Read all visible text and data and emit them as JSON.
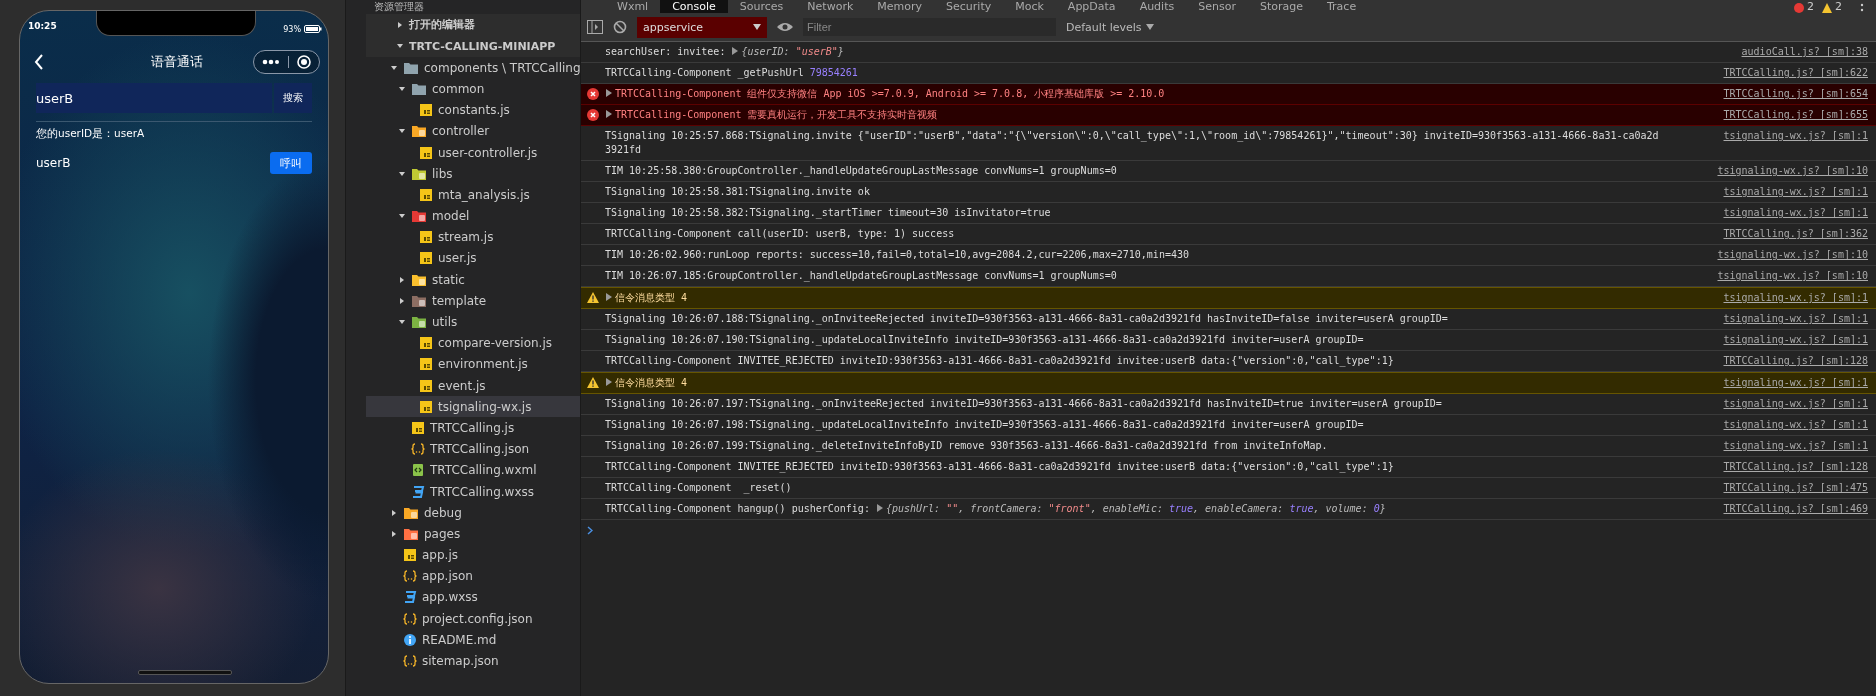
{
  "phone": {
    "status": {
      "time": "10:25",
      "battery": "93%"
    },
    "title": "语音通话",
    "search": {
      "value": "userB",
      "button": "搜索"
    },
    "own_id": "您的userID是：userA",
    "result": {
      "name": "userB",
      "button": "呼叫"
    }
  },
  "explorer": {
    "title": "资源管理器",
    "sections": [
      {
        "label": "打开的编辑器",
        "expanded": false
      },
      {
        "label": "TRTC-CALLING-MINIAPP",
        "expanded": true,
        "items": [
          {
            "kind": "folder",
            "label": "components \\ TRTCCalling",
            "expanded": true,
            "selected": false,
            "children": [
              {
                "kind": "folder",
                "label": "common",
                "expanded": true,
                "selected": false,
                "children": [
                  {
                    "kind": "script",
                    "label": "constants.js",
                    "selected": false
                  }
                ]
              },
              {
                "kind": "controller",
                "label": "controller",
                "expanded": true,
                "selected": false,
                "children": [
                  {
                    "kind": "script",
                    "label": "user-controller.js",
                    "selected": false
                  }
                ]
              },
              {
                "kind": "libs",
                "label": "libs",
                "expanded": true,
                "selected": false,
                "children": [
                  {
                    "kind": "script",
                    "label": "mta_analysis.js",
                    "selected": false
                  }
                ]
              },
              {
                "kind": "model",
                "label": "model",
                "expanded": true,
                "selected": false,
                "children": [
                  {
                    "kind": "script",
                    "label": "stream.js",
                    "selected": false
                  },
                  {
                    "kind": "script",
                    "label": "user.js",
                    "selected": false
                  }
                ]
              },
              {
                "kind": "static",
                "label": "static",
                "expanded": false,
                "selected": false
              },
              {
                "kind": "template",
                "label": "template",
                "expanded": false,
                "selected": false
              },
              {
                "kind": "utils",
                "label": "utils",
                "expanded": true,
                "selected": false,
                "children": [
                  {
                    "kind": "script",
                    "label": "compare-version.js",
                    "selected": false
                  },
                  {
                    "kind": "script",
                    "label": "environment.js",
                    "selected": false
                  },
                  {
                    "kind": "script",
                    "label": "event.js",
                    "selected": false
                  },
                  {
                    "kind": "script",
                    "label": "tsignaling-wx.js",
                    "selected": true
                  }
                ]
              },
              {
                "kind": "script",
                "label": "TRTCCalling.js",
                "selected": false
              },
              {
                "kind": "data",
                "label": "TRTCCalling.json",
                "selected": false
              },
              {
                "kind": "markup",
                "label": "TRTCCalling.wxml",
                "selected": false
              },
              {
                "kind": "style",
                "label": "TRTCCalling.wxss",
                "selected": false
              }
            ]
          },
          {
            "kind": "debug",
            "label": "debug",
            "expanded": false,
            "selected": false
          },
          {
            "kind": "pages",
            "label": "pages",
            "expanded": false,
            "selected": false
          },
          {
            "kind": "script",
            "label": "app.js",
            "selected": false
          },
          {
            "kind": "data",
            "label": "app.json",
            "selected": false
          },
          {
            "kind": "style",
            "label": "app.wxss",
            "selected": false
          },
          {
            "kind": "data",
            "label": "project.config.json",
            "selected": false
          },
          {
            "kind": "readme",
            "label": "README.md",
            "selected": false
          },
          {
            "kind": "data",
            "label": "sitemap.json",
            "selected": false
          }
        ]
      }
    ]
  },
  "devtools": {
    "tabs": [
      {
        "label": "Wxml",
        "selected": false
      },
      {
        "label": "Console",
        "selected": true
      },
      {
        "label": "Sources",
        "selected": false
      },
      {
        "label": "Network",
        "selected": false
      },
      {
        "label": "Memory",
        "selected": false
      },
      {
        "label": "Security",
        "selected": false
      },
      {
        "label": "Mock",
        "selected": false
      },
      {
        "label": "AppData",
        "selected": false
      },
      {
        "label": "Audits",
        "selected": false
      },
      {
        "label": "Sensor",
        "selected": false
      },
      {
        "label": "Storage",
        "selected": false
      },
      {
        "label": "Trace",
        "selected": false
      }
    ],
    "error_count": "2",
    "warning_count": "2",
    "context": "appservice",
    "filter_placeholder": "Filter",
    "levels": "Default levels",
    "rows": [
      {
        "kind": "log",
        "segments": [
          {
            "expandable": false,
            "parts": [
              {
                "text": "searchUser: invitee: ",
                "kind": "text"
              }
            ]
          },
          {
            "expandable": true,
            "parts": [
              {
                "text": "{userID: ",
                "kind": "key"
              },
              {
                "text": "\"userB\"",
                "kind": "string"
              },
              {
                "text": "}",
                "kind": "key"
              }
            ]
          }
        ],
        "source": "audioCall.js? [sm]:38"
      },
      {
        "kind": "log",
        "segments": [
          {
            "expandable": false,
            "parts": [
              {
                "text": "TRTCCalling-Component _getPushUrl ",
                "kind": "text"
              },
              {
                "text": "79854261",
                "kind": "number"
              }
            ]
          }
        ],
        "source": "TRTCCalling.js? [sm]:622"
      },
      {
        "kind": "error",
        "segments": [
          {
            "expandable": true,
            "parts": [
              {
                "text": "TRTCCalling-Component 组件仅支持微信 App iOS >=7.0.9, Android >= 7.0.8, 小程序基础库版 >= 2.10.0",
                "kind": "text"
              }
            ]
          }
        ],
        "source": "TRTCCalling.js? [sm]:654"
      },
      {
        "kind": "error",
        "segments": [
          {
            "expandable": true,
            "parts": [
              {
                "text": "TRTCCalling-Component 需要真机运行，开发工具不支持实时音视频",
                "kind": "text"
              }
            ]
          }
        ],
        "source": "TRTCCalling.js? [sm]:655"
      },
      {
        "kind": "log",
        "segments": [
          {
            "expandable": false,
            "parts": [
              {
                "text": "TSignaling 10:25:57.868:TSignaling.invite {\"userID\":\"userB\",\"data\":\"{\\\"version\\\":0,\\\"call_type\\\":1,\\\"room_id\\\":79854261}\",\"timeout\":30} inviteID=930f3563-a131-4666-8a31-ca0a2d3921fd",
                "kind": "text"
              }
            ]
          }
        ],
        "source": "tsignaling-wx.js? [sm]:1"
      },
      {
        "kind": "log",
        "segments": [
          {
            "expandable": false,
            "parts": [
              {
                "text": "TIM 10:25:58.380:GroupController._handleUpdateGroupLastMessage convNums=1 groupNums=0",
                "kind": "text"
              }
            ]
          }
        ],
        "source": "tsignaling-wx.js? [sm]:10"
      },
      {
        "kind": "log",
        "segments": [
          {
            "expandable": false,
            "parts": [
              {
                "text": "TSignaling 10:25:58.381:TSignaling.invite ok",
                "kind": "text"
              }
            ]
          }
        ],
        "source": "tsignaling-wx.js? [sm]:1"
      },
      {
        "kind": "log",
        "segments": [
          {
            "expandable": false,
            "parts": [
              {
                "text": "TSignaling 10:25:58.382:TSignaling._startTimer timeout=30 isInvitator=true",
                "kind": "text"
              }
            ]
          }
        ],
        "source": "tsignaling-wx.js? [sm]:1"
      },
      {
        "kind": "log",
        "segments": [
          {
            "expandable": false,
            "parts": [
              {
                "text": "TRTCCalling-Component call(userID: userB, type: 1) success",
                "kind": "text"
              }
            ]
          }
        ],
        "source": "TRTCCalling.js? [sm]:362"
      },
      {
        "kind": "log",
        "segments": [
          {
            "expandable": false,
            "parts": [
              {
                "text": "TIM 10:26:02.960:runLoop reports: success=10,fail=0,total=10,avg=2084.2,cur=2206,max=2710,min=430",
                "kind": "text"
              }
            ]
          }
        ],
        "source": "tsignaling-wx.js? [sm]:10"
      },
      {
        "kind": "log",
        "segments": [
          {
            "expandable": false,
            "parts": [
              {
                "text": "TIM 10:26:07.185:GroupController._handleUpdateGroupLastMessage convNums=1 groupNums=0",
                "kind": "text"
              }
            ]
          }
        ],
        "source": "tsignaling-wx.js? [sm]:10"
      },
      {
        "kind": "warning",
        "segments": [
          {
            "expandable": true,
            "parts": [
              {
                "text": "信令消息类型 ",
                "kind": "text"
              },
              {
                "text": "4",
                "kind": "number"
              }
            ]
          }
        ],
        "source": "tsignaling-wx.js? [sm]:1"
      },
      {
        "kind": "log",
        "segments": [
          {
            "expandable": false,
            "parts": [
              {
                "text": "TSignaling 10:26:07.188:TSignaling._onInviteeRejected inviteID=930f3563-a131-4666-8a31-ca0a2d3921fd hasInviteID=false inviter=userA groupID=",
                "kind": "text"
              }
            ]
          }
        ],
        "source": "tsignaling-wx.js? [sm]:1"
      },
      {
        "kind": "log",
        "segments": [
          {
            "expandable": false,
            "parts": [
              {
                "text": "TSignaling 10:26:07.190:TSignaling._updateLocalInviteInfo inviteID=930f3563-a131-4666-8a31-ca0a2d3921fd inviter=userA groupID=",
                "kind": "text"
              }
            ]
          }
        ],
        "source": "tsignaling-wx.js? [sm]:1"
      },
      {
        "kind": "log",
        "segments": [
          {
            "expandable": false,
            "parts": [
              {
                "text": "TRTCCalling-Component INVITEE_REJECTED inviteID:930f3563-a131-4666-8a31-ca0a2d3921fd invitee:userB data:{\"version\":0,\"call_type\":1}",
                "kind": "text"
              }
            ]
          }
        ],
        "source": "TRTCCalling.js? [sm]:128"
      },
      {
        "kind": "warning",
        "segments": [
          {
            "expandable": true,
            "parts": [
              {
                "text": "信令消息类型 ",
                "kind": "text"
              },
              {
                "text": "4",
                "kind": "number"
              }
            ]
          }
        ],
        "source": "tsignaling-wx.js? [sm]:1"
      },
      {
        "kind": "log",
        "segments": [
          {
            "expandable": false,
            "parts": [
              {
                "text": "TSignaling 10:26:07.197:TSignaling._onInviteeRejected inviteID=930f3563-a131-4666-8a31-ca0a2d3921fd hasInviteID=true inviter=userA groupID=",
                "kind": "text"
              }
            ]
          }
        ],
        "source": "tsignaling-wx.js? [sm]:1"
      },
      {
        "kind": "log",
        "segments": [
          {
            "expandable": false,
            "parts": [
              {
                "text": "TSignaling 10:26:07.198:TSignaling._updateLocalInviteInfo inviteID=930f3563-a131-4666-8a31-ca0a2d3921fd inviter=userA groupID=",
                "kind": "text"
              }
            ]
          }
        ],
        "source": "tsignaling-wx.js? [sm]:1"
      },
      {
        "kind": "log",
        "segments": [
          {
            "expandable": false,
            "parts": [
              {
                "text": "TSignaling 10:26:07.199:TSignaling._deleteInviteInfoByID remove 930f3563-a131-4666-8a31-ca0a2d3921fd from inviteInfoMap.",
                "kind": "text"
              }
            ]
          }
        ],
        "source": "tsignaling-wx.js? [sm]:1"
      },
      {
        "kind": "log",
        "segments": [
          {
            "expandable": false,
            "parts": [
              {
                "text": "TRTCCalling-Component INVITEE_REJECTED inviteID:930f3563-a131-4666-8a31-ca0a2d3921fd invitee:userB data:{\"version\":0,\"call_type\":1}",
                "kind": "text"
              }
            ]
          }
        ],
        "source": "TRTCCalling.js? [sm]:128"
      },
      {
        "kind": "log",
        "segments": [
          {
            "expandable": false,
            "parts": [
              {
                "text": "TRTCCalling-Component  _reset()",
                "kind": "text"
              }
            ]
          }
        ],
        "source": "TRTCCalling.js? [sm]:475"
      },
      {
        "kind": "log",
        "segments": [
          {
            "expandable": false,
            "parts": [
              {
                "text": "TRTCCalling-Component hangup() pusherConfig: ",
                "kind": "text"
              }
            ]
          },
          {
            "expandable": true,
            "parts": [
              {
                "text": "{pushUrl: ",
                "kind": "key"
              },
              {
                "text": "\"\"",
                "kind": "string"
              },
              {
                "text": ", frontCamera: ",
                "kind": "key"
              },
              {
                "text": "\"front\"",
                "kind": "string"
              },
              {
                "text": ", enableMic: ",
                "kind": "key"
              },
              {
                "text": "true",
                "kind": "keyword"
              },
              {
                "text": ", enableCamera: ",
                "kind": "key"
              },
              {
                "text": "true",
                "kind": "keyword"
              },
              {
                "text": ", volume: ",
                "kind": "key"
              },
              {
                "text": "0",
                "kind": "number"
              },
              {
                "text": "}",
                "kind": "key"
              }
            ]
          }
        ],
        "source": "TRTCCalling.js? [sm]:469"
      }
    ]
  }
}
